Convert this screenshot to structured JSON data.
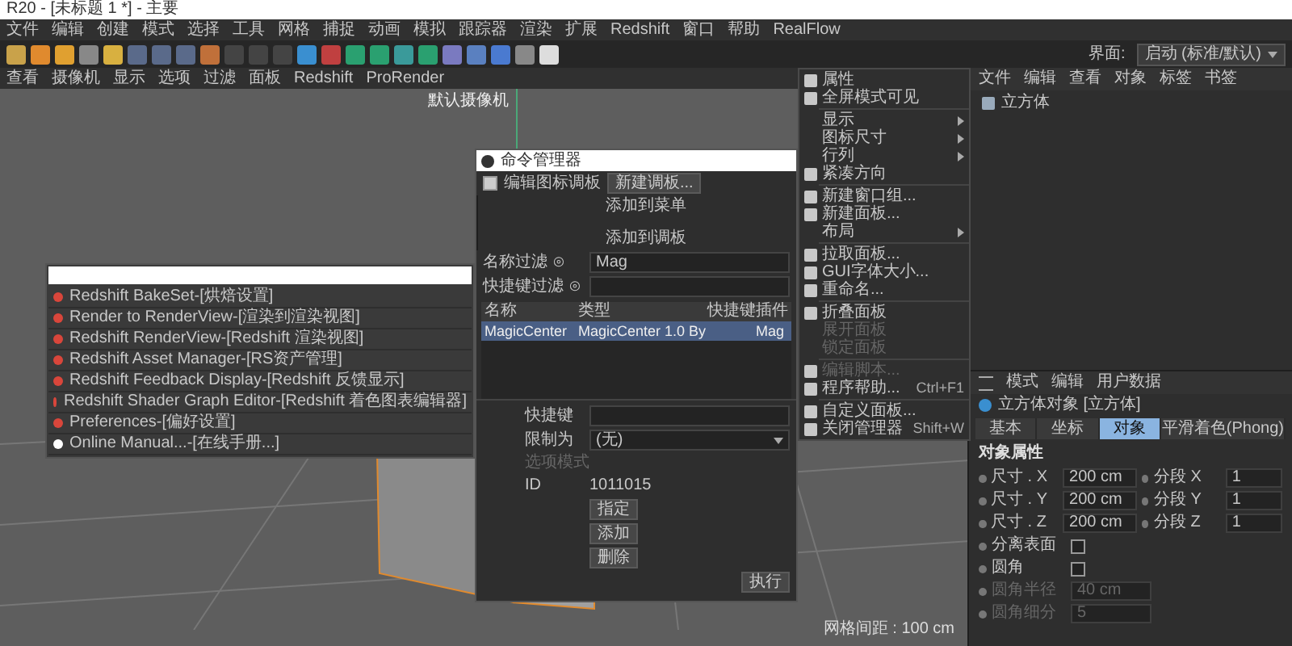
{
  "window": {
    "title": "R20 - [未标题 1 *] - 主要"
  },
  "menu_bar": [
    "文件",
    "编辑",
    "创建",
    "模式",
    "选择",
    "工具",
    "网格",
    "捕捉",
    "动画",
    "模拟",
    "跟踪器",
    "渲染",
    "扩展",
    "Redshift",
    "窗口",
    "帮助",
    "RealFlow"
  ],
  "layout_selector": {
    "label": "界面:",
    "value": "启动 (标准/默认)"
  },
  "viewport_menu": [
    "查看",
    "摄像机",
    "显示",
    "选项",
    "过滤",
    "面板",
    "Redshift",
    "ProRender"
  ],
  "viewport": {
    "camera_label": "默认摄像机",
    "grid_spacing": "网格间距 : 100 cm"
  },
  "command_popup": {
    "items": [
      {
        "label": "Redshift BakeSet-[烘焙设置]",
        "color": "#d9463b"
      },
      {
        "label": "Render to RenderView-[渲染到渲染视图]",
        "color": "#d9463b"
      },
      {
        "label": "Redshift RenderView-[Redshift 渲染视图]",
        "color": "#d9463b"
      },
      {
        "label": "Redshift Asset Manager-[RS资产管理]",
        "color": "#d9463b"
      },
      {
        "label": "Redshift Feedback Display-[Redshift 反馈显示]",
        "color": "#d9463b"
      },
      {
        "label": "Redshift Shader Graph Editor-[Redshift 着色图表编辑器]",
        "color": "#d9463b"
      },
      {
        "label": "Preferences-[偏好设置]",
        "color": "#d9463b"
      },
      {
        "label": "Online Manual...-[在线手册...]",
        "color": "#ffffff"
      }
    ]
  },
  "command_manager": {
    "title": "命令管理器",
    "edit_palette": {
      "label": "编辑图标调板",
      "checked": true
    },
    "new_palette_button": "新建调板...",
    "actions": [
      "添加到菜单",
      "添加到调板"
    ],
    "name_filter": {
      "label": "名称过滤 ⊙",
      "value": "Mag"
    },
    "shortcut_filter": {
      "label": "快捷键过滤 ⊙"
    },
    "columns": [
      "名称",
      "类型",
      "快捷键",
      "插件"
    ],
    "rows": [
      {
        "cells": [
          "MagicCenter",
          "MagicCenter 1.0 By",
          "",
          "Mag"
        ],
        "selected": true
      }
    ],
    "shortcut": {
      "label": "快捷键"
    },
    "restrict": {
      "label": "限制为",
      "value": "(无)"
    },
    "option_mode": {
      "label": "选项模式",
      "disabled": true
    },
    "id": {
      "label": "ID",
      "value": "1011015"
    },
    "buttons": [
      "指定",
      "添加",
      "删除"
    ],
    "execute_button": "执行"
  },
  "context_menu": {
    "items": [
      {
        "kind": "item",
        "label": "属性",
        "icon": true,
        "submenu": false,
        "disabled": false
      },
      {
        "kind": "item",
        "label": "全屏模式可见",
        "icon": true,
        "submenu": false,
        "disabled": false
      },
      {
        "kind": "separator"
      },
      {
        "kind": "item",
        "label": "显示",
        "icon": false,
        "submenu": true,
        "disabled": false
      },
      {
        "kind": "item",
        "label": "图标尺寸",
        "icon": false,
        "submenu": true,
        "disabled": false
      },
      {
        "kind": "item",
        "label": "行列",
        "icon": false,
        "submenu": true,
        "disabled": false
      },
      {
        "kind": "item",
        "label": "紧凑方向",
        "icon": true,
        "submenu": false,
        "disabled": false
      },
      {
        "kind": "separator"
      },
      {
        "kind": "item",
        "label": "新建窗口组...",
        "icon": true,
        "submenu": false,
        "disabled": false
      },
      {
        "kind": "item",
        "label": "新建面板...",
        "icon": true,
        "submenu": false,
        "disabled": false
      },
      {
        "kind": "item",
        "label": "布局",
        "icon": false,
        "submenu": true,
        "disabled": false
      },
      {
        "kind": "separator"
      },
      {
        "kind": "item",
        "label": "拉取面板...",
        "icon": true,
        "submenu": false,
        "disabled": false
      },
      {
        "kind": "item",
        "label": "GUI字体大小...",
        "icon": true,
        "submenu": false,
        "disabled": false
      },
      {
        "kind": "item",
        "label": "重命名...",
        "icon": true,
        "submenu": false,
        "disabled": false
      },
      {
        "kind": "separator"
      },
      {
        "kind": "item",
        "label": "折叠面板",
        "icon": true,
        "submenu": false,
        "disabled": false
      },
      {
        "kind": "item",
        "label": "展开面板",
        "icon": false,
        "submenu": false,
        "disabled": true
      },
      {
        "kind": "item",
        "label": "锁定面板",
        "icon": false,
        "submenu": false,
        "disabled": true
      },
      {
        "kind": "separator"
      },
      {
        "kind": "item",
        "label": "编辑脚本...",
        "icon": true,
        "submenu": false,
        "disabled": true
      },
      {
        "kind": "item",
        "label": "程序帮助...",
        "shortcut": "Ctrl+F1",
        "icon": true,
        "submenu": false,
        "disabled": false
      },
      {
        "kind": "separator"
      },
      {
        "kind": "item",
        "label": "自定义面板...",
        "icon": true,
        "submenu": false,
        "disabled": false
      },
      {
        "kind": "item",
        "label": "关闭管理器",
        "shortcut": "Shift+W",
        "icon": true,
        "submenu": false,
        "disabled": false
      }
    ]
  },
  "object_manager": {
    "menu": [
      "文件",
      "编辑",
      "查看",
      "对象",
      "标签",
      "书签"
    ],
    "objects": [
      {
        "name": "立方体"
      }
    ]
  },
  "attributes": {
    "menu": [
      "模式",
      "编辑",
      "用户数据"
    ],
    "object_title": "立方体对象 [立方体]",
    "tabs": [
      {
        "label": "基本",
        "selected": false
      },
      {
        "label": "坐标",
        "selected": false
      },
      {
        "label": "对象",
        "selected": true
      },
      {
        "label": "平滑着色(Phong)",
        "selected": false
      }
    ],
    "section": "对象属性",
    "sizes": [
      {
        "label": "尺寸 . X",
        "value": "200 cm",
        "seg_label": "分段 X",
        "seg_value": "1"
      },
      {
        "label": "尺寸 . Y",
        "value": "200 cm",
        "seg_label": "分段 Y",
        "seg_value": "1"
      },
      {
        "label": "尺寸 . Z",
        "value": "200 cm",
        "seg_label": "分段 Z",
        "seg_value": "1"
      }
    ],
    "checks": [
      {
        "label": "分离表面",
        "checked": false
      },
      {
        "label": "圆角",
        "checked": false
      }
    ],
    "fillet": [
      {
        "label": "圆角半径",
        "value": "40 cm",
        "disabled": true
      },
      {
        "label": "圆角细分",
        "value": "5",
        "disabled": true
      }
    ]
  }
}
